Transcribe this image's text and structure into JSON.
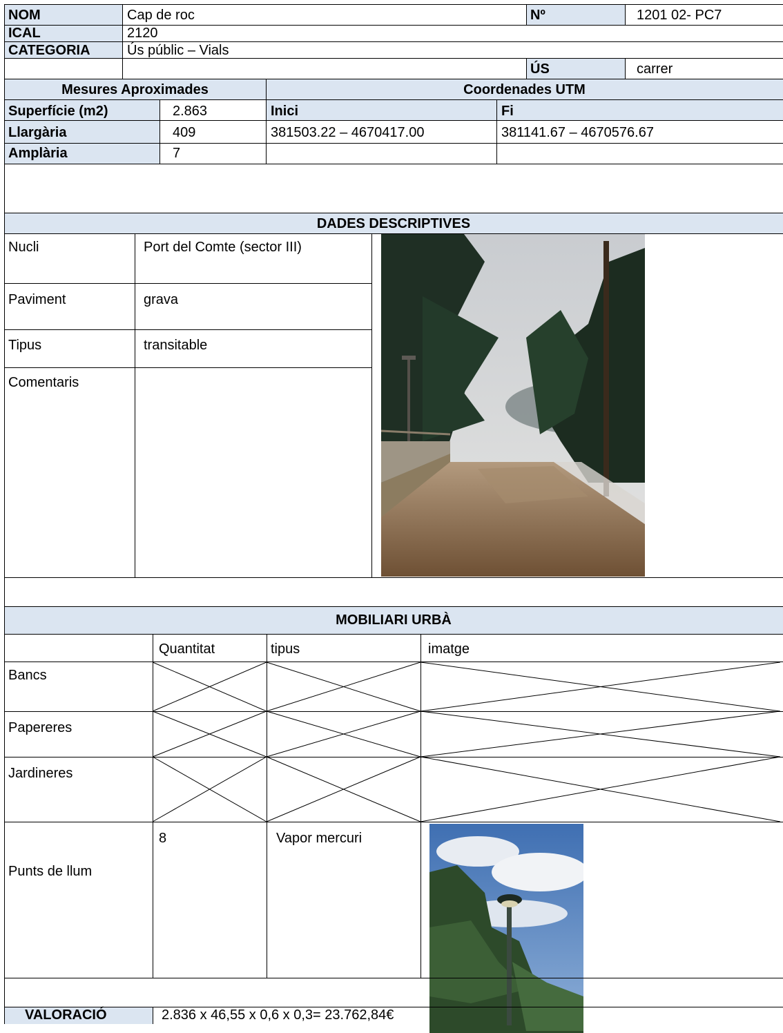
{
  "header": {
    "nom_label": "NOM",
    "nom_value": "Cap de roc",
    "num_label": "Nº",
    "num_value": "1201 02- PC7",
    "ical_label": "ICAL",
    "ical_value": "2120",
    "categoria_label": "CATEGORIA",
    "categoria_value": "Ús públic – Vials",
    "us_label": "ÚS",
    "us_value": "carrer"
  },
  "measures": {
    "title": "Mesures Aproximades",
    "rows": [
      {
        "label": "Superfície (m2)",
        "value": "2.863"
      },
      {
        "label": "Llargària",
        "value": "409"
      },
      {
        "label": "Amplària",
        "value": "7"
      }
    ]
  },
  "utm": {
    "title": "Coordenades UTM",
    "start_label": "Inici",
    "end_label": "Fi",
    "start_value": "381503.22 – 4670417.00",
    "end_value": "381141.67 – 4670576.67"
  },
  "descriptive": {
    "title": "DADES DESCRIPTIVES",
    "rows": [
      {
        "label": "Nucli",
        "value": "Port del Comte (sector III)"
      },
      {
        "label": "Paviment",
        "value": "grava"
      },
      {
        "label": "Tipus",
        "value": "transitable"
      },
      {
        "label": "Comentaris",
        "value": ""
      }
    ],
    "photo_icon": "road-forest-photo"
  },
  "furniture": {
    "title": "MOBILIARI URBÀ",
    "columns": [
      "Quantitat",
      "tipus",
      "imatge"
    ],
    "rows": [
      {
        "label": "Bancs"
      },
      {
        "label": "Papereres"
      },
      {
        "label": "Jardineres"
      },
      {
        "label": "Punts de llum",
        "quantity": "8",
        "type": "Vapor mercuri"
      }
    ],
    "photo_icon": "street-lamp-photo"
  },
  "valuation": {
    "label": "VALORACIÓ",
    "value": "2.836 x 46,55 x 0,6 x 0,3= 23.762,84€"
  }
}
